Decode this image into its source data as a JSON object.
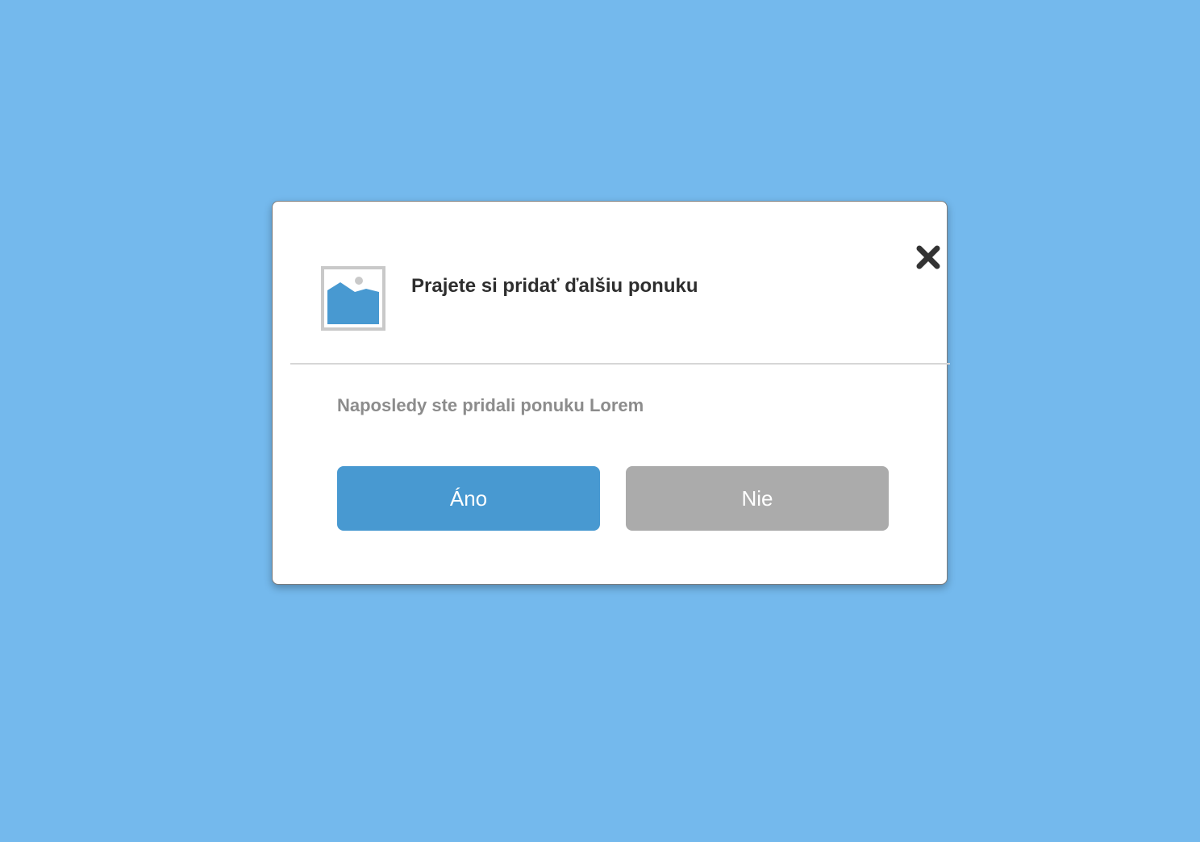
{
  "dialog": {
    "title": "Prajete si pridať ďalšiu ponuku",
    "message": "Naposledy ste pridali ponuku Lorem",
    "yes_label": "Áno",
    "no_label": "Nie",
    "icons": {
      "header": "image-placeholder-icon",
      "close": "close-icon"
    }
  },
  "colors": {
    "background": "#74b9ed",
    "primary_button": "#4899d1",
    "secondary_button": "#ababab",
    "title_text": "#2e2e2e",
    "message_text": "#8c8c8c"
  }
}
